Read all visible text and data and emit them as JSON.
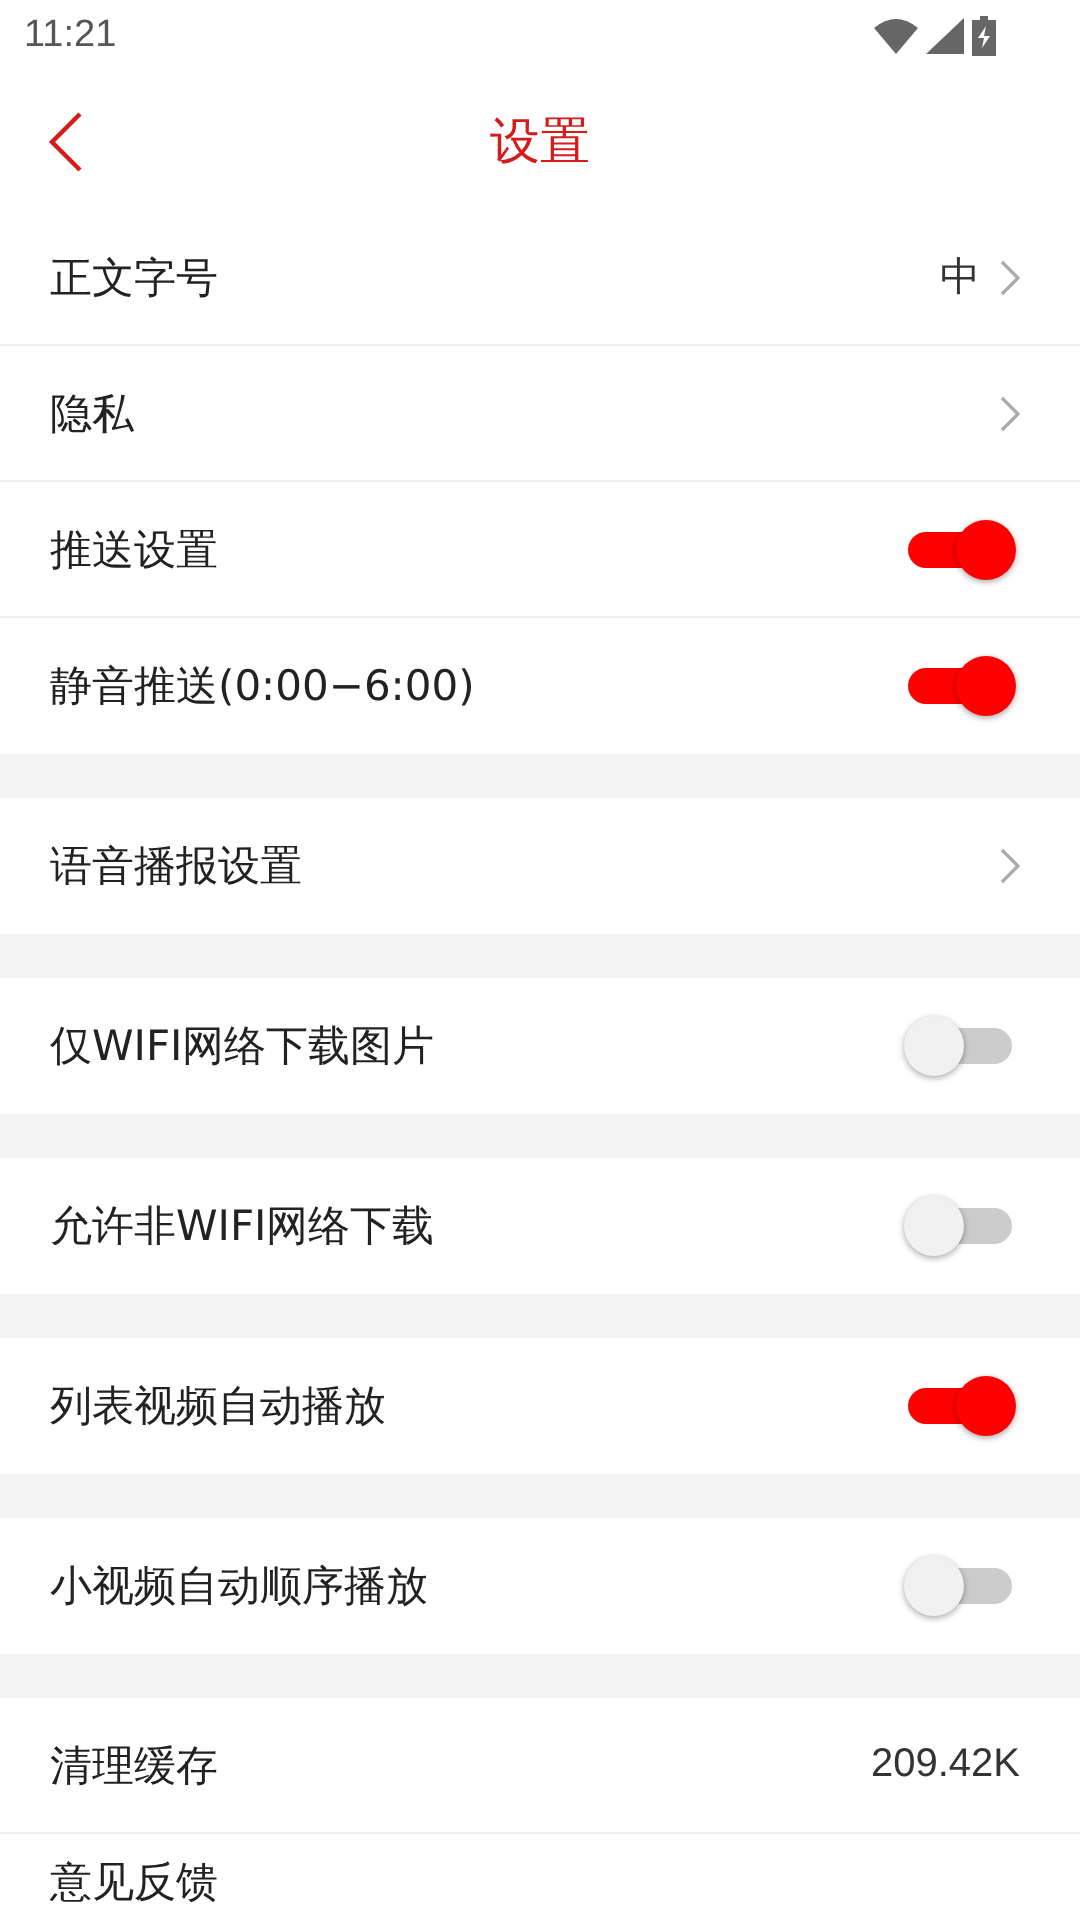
{
  "status_bar": {
    "time": "11:21"
  },
  "header": {
    "title": "设置"
  },
  "sections": [
    {
      "items": [
        {
          "kind": "arrow",
          "label": "正文字号",
          "value": "中"
        },
        {
          "kind": "arrow",
          "label": "隐私"
        },
        {
          "kind": "toggle",
          "label": "推送设置",
          "on": true
        },
        {
          "kind": "toggle",
          "label": "静音推送(0:00−6:00)",
          "on": true
        }
      ]
    },
    {
      "items": [
        {
          "kind": "arrow",
          "label": "语音播报设置"
        }
      ]
    },
    {
      "items": [
        {
          "kind": "toggle",
          "label": "仅WIFI网络下载图片",
          "on": false
        }
      ]
    },
    {
      "items": [
        {
          "kind": "toggle",
          "label": "允许非WIFI网络下载",
          "on": false
        }
      ]
    },
    {
      "items": [
        {
          "kind": "toggle",
          "label": "列表视频自动播放",
          "on": true
        }
      ]
    },
    {
      "items": [
        {
          "kind": "toggle",
          "label": "小视频自动顺序播放",
          "on": false
        }
      ]
    },
    {
      "items": [
        {
          "kind": "value",
          "label": "清理缓存",
          "value": "209.42K"
        },
        {
          "kind": "plain",
          "label": "意见反馈"
        }
      ]
    }
  ]
}
